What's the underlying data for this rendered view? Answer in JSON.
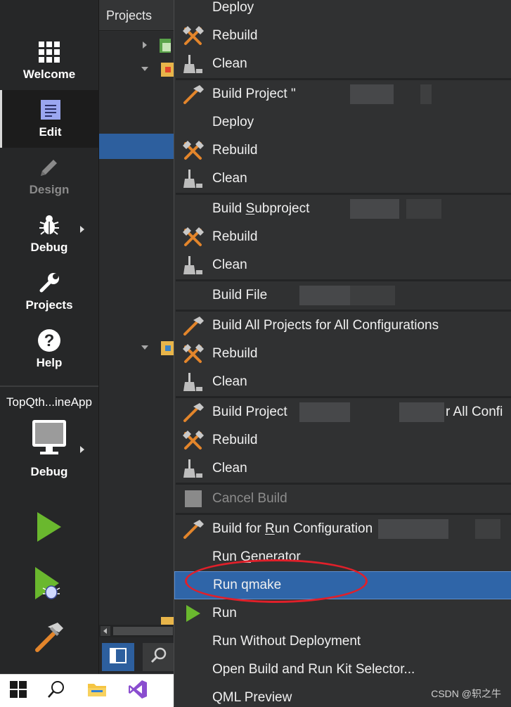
{
  "sidebar": {
    "modes": [
      {
        "label": "Welcome",
        "icon": "grid-icon",
        "state": "normal"
      },
      {
        "label": "Edit",
        "icon": "document-icon",
        "state": "active"
      },
      {
        "label": "Design",
        "icon": "pencil-icon",
        "state": "disabled"
      },
      {
        "label": "Debug",
        "icon": "bug-icon",
        "state": "normal"
      },
      {
        "label": "Projects",
        "icon": "wrench-icon",
        "state": "normal"
      },
      {
        "label": "Help",
        "icon": "help-icon",
        "state": "normal"
      }
    ],
    "kit": {
      "project_name": "TopQth...ineApp",
      "build_config": "Debug",
      "icon": "monitor-icon"
    },
    "actions": [
      {
        "name": "run-button",
        "icon": "run-icon"
      },
      {
        "name": "start-debugging-button",
        "icon": "run-debug-icon"
      },
      {
        "name": "build-button",
        "icon": "hammer-icon"
      }
    ]
  },
  "projects_pane": {
    "title": "Projects"
  },
  "context_menu": {
    "items": [
      {
        "label": "Deploy",
        "icon": "",
        "state": "normal"
      },
      {
        "label": "Rebuild",
        "icon": "rebuild-icon",
        "state": "normal"
      },
      {
        "label": "Clean",
        "icon": "clean-icon",
        "state": "normal"
      },
      {
        "label": "Build Project \"",
        "icon": "build-icon",
        "state": "normal"
      },
      {
        "label": "Deploy",
        "icon": "",
        "state": "normal"
      },
      {
        "label": "Rebuild",
        "icon": "rebuild-icon",
        "state": "normal"
      },
      {
        "label": "Clean",
        "icon": "clean-icon",
        "state": "normal"
      },
      {
        "label": "Build Subproject",
        "icon": "",
        "state": "normal"
      },
      {
        "label": "Rebuild",
        "icon": "rebuild-icon",
        "state": "normal"
      },
      {
        "label": "Clean",
        "icon": "clean-icon",
        "state": "normal"
      },
      {
        "label": "Build File",
        "icon": "",
        "state": "normal"
      },
      {
        "label": "Build All Projects for All Configurations",
        "icon": "build-icon",
        "state": "normal"
      },
      {
        "label": "Rebuild",
        "icon": "rebuild-icon",
        "state": "normal"
      },
      {
        "label": "Clean",
        "icon": "clean-icon",
        "state": "normal"
      },
      {
        "label": "Build Project",
        "suffix": "r All Confi",
        "icon": "build-icon",
        "state": "normal"
      },
      {
        "label": "Rebuild",
        "icon": "rebuild-icon",
        "state": "normal"
      },
      {
        "label": "Clean",
        "icon": "clean-icon",
        "state": "normal"
      },
      {
        "label": "Cancel Build",
        "icon": "stop-icon",
        "state": "disabled"
      },
      {
        "label": "Build for Run Configuration",
        "icon": "build-icon",
        "state": "normal"
      },
      {
        "label": "Run Generator",
        "icon": "",
        "state": "normal"
      },
      {
        "label": "Run qmake",
        "icon": "",
        "state": "highlighted"
      },
      {
        "label": "Run",
        "icon": "run-icon",
        "state": "normal"
      },
      {
        "label": "Run Without Deployment",
        "icon": "",
        "state": "normal"
      },
      {
        "label": "Open Build and Run Kit Selector...",
        "icon": "",
        "state": "normal"
      },
      {
        "label": "QML Preview",
        "icon": "",
        "state": "normal"
      }
    ]
  },
  "taskbar": {
    "items": [
      {
        "name": "windows-start-button",
        "icon": "windows-logo-icon"
      },
      {
        "name": "taskbar-search-button",
        "icon": "search-icon"
      },
      {
        "name": "taskbar-file-explorer",
        "icon": "folder-icon"
      },
      {
        "name": "taskbar-visual-studio",
        "icon": "visual-studio-icon"
      }
    ]
  },
  "watermark": "CSDN @轵之牛",
  "colors": {
    "menu_bg": "#303132",
    "highlight": "#2f65a8",
    "sidebar_bg": "#262728",
    "run_green": "#6ab82e",
    "tool_orange": "#e3852b",
    "annotation_red": "#e0202a"
  }
}
